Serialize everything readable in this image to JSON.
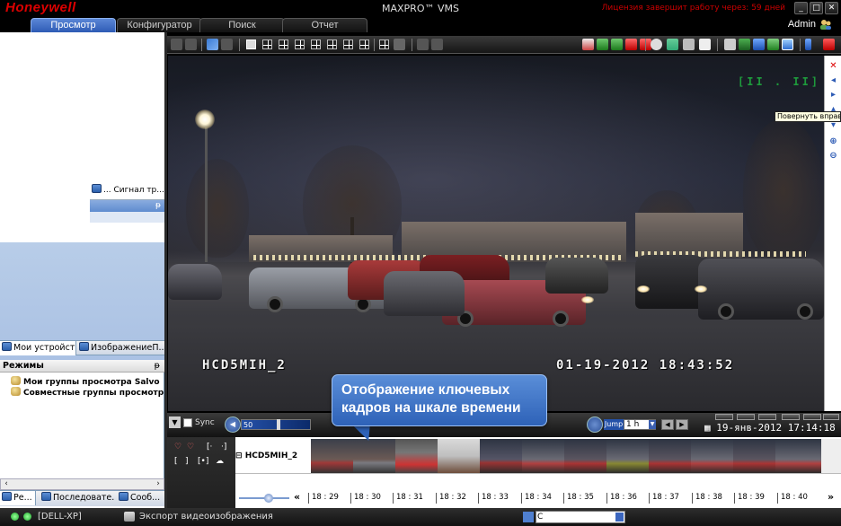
{
  "app": {
    "brand": "Honeywell",
    "title": "MAXPRO™ VMS",
    "license_notice": "Лицензия завершит работу через: 59 дней",
    "user": "Admin"
  },
  "tabs": [
    {
      "label": "Просмотр",
      "active": true
    },
    {
      "label": "Конфигуратор",
      "active": false
    },
    {
      "label": "Поиск",
      "active": false
    },
    {
      "label": "Отчет",
      "active": false
    }
  ],
  "left_panel": {
    "signal_item": "... Сигнал тр...",
    "pin_glyph": "ᵽ",
    "tabs_top": [
      {
        "label": "Мои устройства",
        "active": true
      },
      {
        "label": "ИзображениеП...",
        "active": false
      }
    ],
    "modes": {
      "title": "Режимы",
      "items": [
        "Мои группы просмотра Salvo",
        "Совместные группы просмотра Salvo"
      ]
    },
    "tabs_bottom": [
      {
        "label": "Ре...",
        "active": true
      },
      {
        "label": "Последовате...",
        "active": false
      },
      {
        "label": "Сооб...",
        "active": false
      }
    ]
  },
  "video": {
    "camera_osd": "HCD5MIH_2",
    "timestamp_osd": "01-19-2012 18:43:52",
    "record_indicator": "[II . II]",
    "tooltip": "Повернуть вправо"
  },
  "playback": {
    "sync_label": "Sync",
    "speed_value": "50",
    "jump_label": "Jump",
    "jump_value": "1 h",
    "date": "19-янв-2012",
    "time": "17:14:18"
  },
  "callout": {
    "line1": "Отображение ключевых",
    "line2": "кадров на шкале времени"
  },
  "timeline": {
    "camera": "HCD5MIH_2",
    "ticks": [
      "18 : 29",
      "18 : 30",
      "18 : 31",
      "18 : 32",
      "18 : 33",
      "18 : 34",
      "18 : 35",
      "18 : 36",
      "18 : 37",
      "18 : 38",
      "18 : 39",
      "18 : 40"
    ]
  },
  "statusbar": {
    "host": "[DELL-XP]",
    "export": "Экспорт видеоизображения",
    "search_value": "C"
  },
  "colors": {
    "brand": "#d00000",
    "accent_blue": "#2d5bb5",
    "osd_green": "#1e9b3c"
  }
}
